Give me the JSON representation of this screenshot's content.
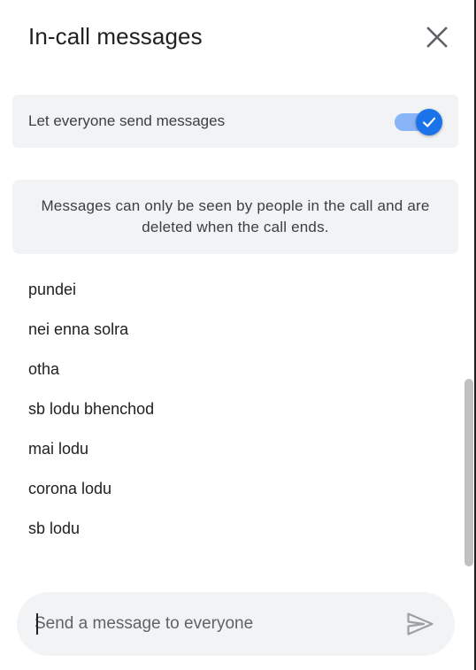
{
  "header": {
    "title": "In-call messages",
    "close_icon": "close-icon"
  },
  "settings": {
    "toggle_label": "Let everyone send messages",
    "toggle_on": true,
    "toggle_icon": "checkmark-icon",
    "accent_color": "#1a73e8",
    "track_color": "#8ab4f8"
  },
  "info": {
    "text": "Messages can only be seen by people in the call and are deleted when the call ends."
  },
  "messages": [
    {
      "text": "pundei"
    },
    {
      "text": "nei enna solra"
    },
    {
      "text": "otha"
    },
    {
      "text": "sb lodu bhenchod"
    },
    {
      "text": "mai lodu"
    },
    {
      "text": "corona lodu"
    },
    {
      "text": "sb lodu"
    }
  ],
  "composer": {
    "placeholder": "Send a message to everyone",
    "value": "",
    "send_icon": "send-icon"
  },
  "colors": {
    "card_background": "#f1f3f4",
    "text_primary": "#202124",
    "text_secondary": "#3c4043"
  }
}
